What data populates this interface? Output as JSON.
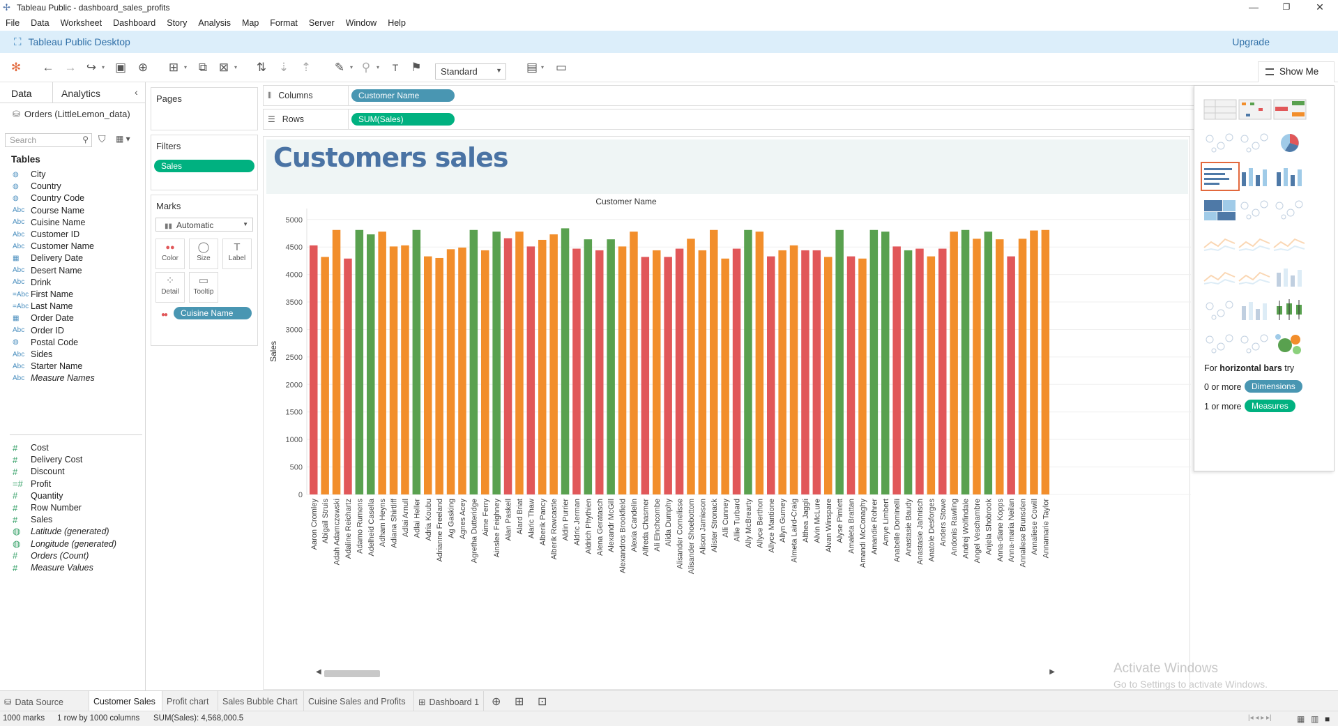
{
  "window": {
    "title": "Tableau Public - dashboard_sales_profits",
    "minimize": "—",
    "restore": "❐",
    "close": "✕"
  },
  "menu": [
    "File",
    "Data",
    "Worksheet",
    "Dashboard",
    "Story",
    "Analysis",
    "Map",
    "Format",
    "Server",
    "Window",
    "Help"
  ],
  "brand": {
    "name": "Tableau Public Desktop",
    "upgrade": "Upgrade"
  },
  "toolbar": {
    "fit": "Standard",
    "show_me": "Show Me"
  },
  "data_pane": {
    "tab_data": "Data",
    "tab_analytics": "Analytics",
    "datasource": "Orders (LittleLemon_data)",
    "search_placeholder": "Search",
    "tables_title": "Tables",
    "dimensions": [
      {
        "type": "geo",
        "name": "City",
        "italic": false
      },
      {
        "type": "geo",
        "name": "Country",
        "italic": false
      },
      {
        "type": "geo",
        "name": "Country Code",
        "italic": false
      },
      {
        "type": "Abc",
        "name": "Course Name",
        "italic": false
      },
      {
        "type": "Abc",
        "name": "Cuisine Name",
        "italic": false
      },
      {
        "type": "Abc",
        "name": "Customer ID",
        "italic": false
      },
      {
        "type": "Abc",
        "name": "Customer Name",
        "italic": false
      },
      {
        "type": "date",
        "name": "Delivery Date",
        "italic": false
      },
      {
        "type": "Abc",
        "name": "Desert Name",
        "italic": false
      },
      {
        "type": "Abc",
        "name": "Drink",
        "italic": false
      },
      {
        "type": "=Abc",
        "name": "First Name",
        "italic": false
      },
      {
        "type": "=Abc",
        "name": "Last Name",
        "italic": false
      },
      {
        "type": "date",
        "name": "Order Date",
        "italic": false
      },
      {
        "type": "Abc",
        "name": "Order ID",
        "italic": false
      },
      {
        "type": "geo",
        "name": "Postal Code",
        "italic": false
      },
      {
        "type": "Abc",
        "name": "Sides",
        "italic": false
      },
      {
        "type": "Abc",
        "name": "Starter Name",
        "italic": false
      },
      {
        "type": "Abc",
        "name": "Measure Names",
        "italic": true
      }
    ],
    "measures": [
      {
        "type": "#",
        "name": "Cost",
        "italic": false
      },
      {
        "type": "#",
        "name": "Delivery Cost",
        "italic": false
      },
      {
        "type": "#",
        "name": "Discount",
        "italic": false
      },
      {
        "type": "=#",
        "name": "Profit",
        "italic": false
      },
      {
        "type": "#",
        "name": "Quantity",
        "italic": false
      },
      {
        "type": "#",
        "name": "Row Number",
        "italic": false
      },
      {
        "type": "#",
        "name": "Sales",
        "italic": false
      },
      {
        "type": "geo",
        "name": "Latitude (generated)",
        "italic": true
      },
      {
        "type": "geo",
        "name": "Longitude (generated)",
        "italic": true
      },
      {
        "type": "#",
        "name": "Orders (Count)",
        "italic": true
      },
      {
        "type": "#",
        "name": "Measure Values",
        "italic": true
      }
    ]
  },
  "cards": {
    "pages": "Pages",
    "filters": "Filters",
    "filter_pill": "Sales",
    "marks": "Marks",
    "mark_type": "Automatic",
    "mark_buttons": [
      {
        "label": "Color",
        "icon": "●●"
      },
      {
        "label": "Size",
        "icon": "◯"
      },
      {
        "label": "Label",
        "icon": "T"
      },
      {
        "label": "Detail",
        "icon": "⁘"
      },
      {
        "label": "Tooltip",
        "icon": "▭"
      }
    ],
    "color_pill": "Cuisine Name"
  },
  "shelves": {
    "columns_label": "Columns",
    "columns_pill": "Customer Name",
    "rows_label": "Rows",
    "rows_pill": "SUM(Sales)"
  },
  "viz": {
    "title": "Customers sales"
  },
  "colors": {
    "red": "#e15759",
    "orange": "#f28e2b",
    "green": "#59a14f",
    "title": "#4a73a4"
  },
  "chart_data": {
    "type": "bar",
    "title": "Customers sales",
    "xlabel": "Customer Name",
    "ylabel": "Sales",
    "ylim": [
      0,
      5200
    ],
    "yticks": [
      0,
      500,
      1000,
      1500,
      2000,
      2500,
      3000,
      3500,
      4000,
      4500,
      5000
    ],
    "grid": true,
    "series_by_color": "Cuisine Name",
    "categories": [
      "Aaron Cromley",
      "Abigail Struis",
      "Adah Adamczewski",
      "Adaline Reichartz",
      "Adamo Rumens",
      "Adelheid Casella",
      "Adham Heyns",
      "Adiana Shirtliff",
      "Adlai Arnull",
      "Adlai Heller",
      "Adria Koubu",
      "Adrianne Freeland",
      "Ag Gasking",
      "Agnes Acey",
      "Agretha Dutteridge",
      "Aime Ferry",
      "Ainslee Feighney",
      "Alan Paskell",
      "Alard Briat",
      "Alaric Thaw",
      "Alberik Pancy",
      "Alberik Rowcastle",
      "Aldin Purrier",
      "Aldric Jerman",
      "Aldrich Phythien",
      "Alena Geratasch",
      "Alexandr McGill",
      "Alexandros Brookfield",
      "Alexia Candelin",
      "Alfreda Chasmer",
      "Ali Elnchcombe",
      "Alida Dumphy",
      "Alisander Cornelisse",
      "Alisander Shoebottom",
      "Alison Jamieson",
      "Alister Stronack",
      "Alli Cunney",
      "Allie Turbard",
      "Ally McBrearty",
      "Allyce Berthon",
      "Allyce Mantione",
      "Allyn Gurney",
      "Almeta Laird-Craig",
      "Althea Jaggli",
      "Alvin McLure",
      "Alvan Winspare",
      "Alyse Pimlett",
      "Amaleta Brattan",
      "Amandi McConaghy",
      "Amandie Rohrer",
      "Amye Limbert",
      "Anabelle Dominelli",
      "Anastasie Baudy",
      "Anastasie Jahnisch",
      "Anatole Desforges",
      "Anders Stowe",
      "Andonis Rawling",
      "Andrej Wolfindale",
      "Angel Veschambre",
      "Anjela Shobrook",
      "Anna-diane Kopps",
      "Anna-maria Neilan",
      "Annaliese Brunsden",
      "Annaliese Cowill",
      "Annamarie Taylor"
    ],
    "values": [
      4530,
      4320,
      4810,
      4290,
      4810,
      4730,
      4780,
      4510,
      4530,
      4810,
      4330,
      4300,
      4460,
      4490,
      4810,
      4440,
      4780,
      4660,
      4780,
      4510,
      4630,
      4730,
      4840,
      4470,
      4640,
      4440,
      4640,
      4510,
      4780,
      4320,
      4440,
      4320,
      4470,
      4650,
      4440,
      4810,
      4290,
      4470,
      4810,
      4780,
      4330,
      4440,
      4530,
      4440,
      4440,
      4320,
      4810,
      4330,
      4290,
      4810,
      4780,
      4510,
      4440,
      4470,
      4330,
      4470,
      4780,
      4810,
      4650,
      4780,
      4640,
      4330,
      4650,
      4800,
      4810
    ],
    "cuisines": [
      "r",
      "o",
      "o",
      "r",
      "g",
      "g",
      "o",
      "o",
      "o",
      "g",
      "o",
      "o",
      "o",
      "o",
      "g",
      "o",
      "g",
      "r",
      "o",
      "r",
      "o",
      "o",
      "g",
      "r",
      "g",
      "r",
      "g",
      "o",
      "o",
      "r",
      "o",
      "r",
      "r",
      "o",
      "o",
      "o",
      "o",
      "r",
      "g",
      "o",
      "r",
      "o",
      "o",
      "r",
      "r",
      "o",
      "g",
      "r",
      "o",
      "g",
      "g",
      "r",
      "g",
      "r",
      "o",
      "r",
      "o",
      "g",
      "o",
      "g",
      "o",
      "r",
      "o",
      "o",
      "o"
    ]
  },
  "show_me": {
    "hint_prefix": "For ",
    "hint_bold": "horizontal bars",
    "hint_suffix": " try",
    "dims_count": "0 or more",
    "dims_pill": "Dimensions",
    "meas_count": "1 or more",
    "meas_pill": "Measures"
  },
  "tabs": [
    "Data Source",
    "Customer Sales",
    "Profit chart",
    "Sales Bubble Chart",
    "Cuisine Sales and Profits",
    "Dashboard 1"
  ],
  "status": {
    "marks": "1000 marks",
    "rows": "1 row by 1000 columns",
    "sum": "SUM(Sales): 4,568,000.5"
  },
  "watermark": {
    "line1": "Activate Windows",
    "line2": "Go to Settings to activate Windows."
  }
}
